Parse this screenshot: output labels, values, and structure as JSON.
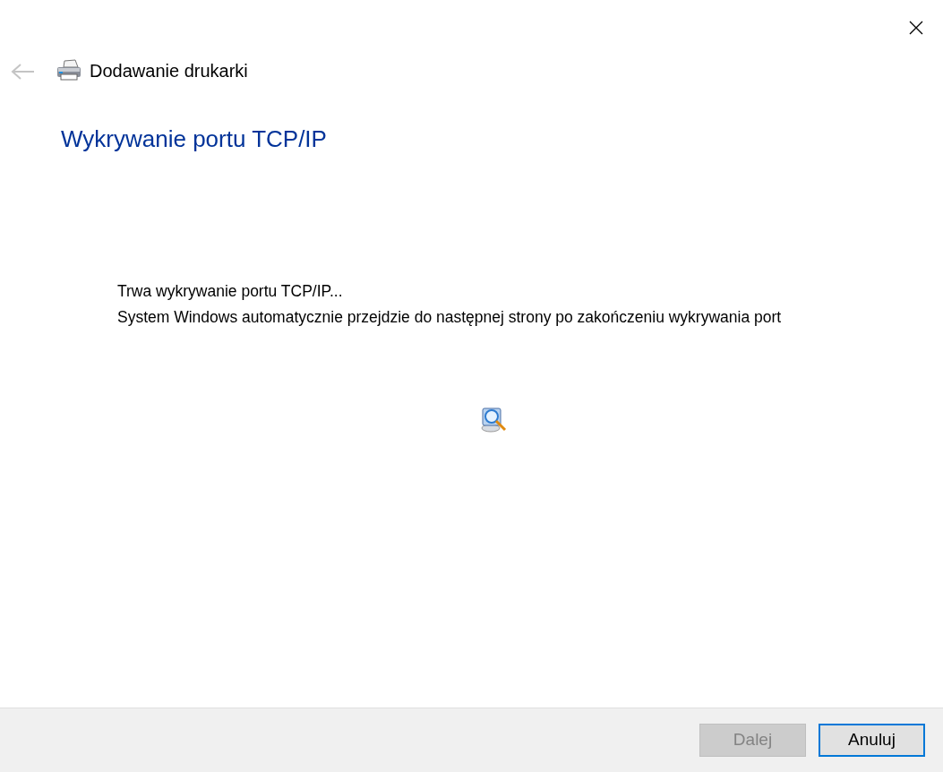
{
  "window": {
    "title": "Dodawanie drukarki",
    "back_disabled": true
  },
  "heading": "Wykrywanie portu TCP/IP",
  "message": [
    "Trwa wykrywanie portu TCP/IP...",
    "System Windows automatycznie przejdzie do następnej strony po zakończeniu wykrywania port"
  ],
  "buttons": [
    {
      "label": "Dalej",
      "disabled": true,
      "focused": false
    },
    {
      "label": "Anuluj",
      "disabled": false,
      "focused": true
    }
  ]
}
